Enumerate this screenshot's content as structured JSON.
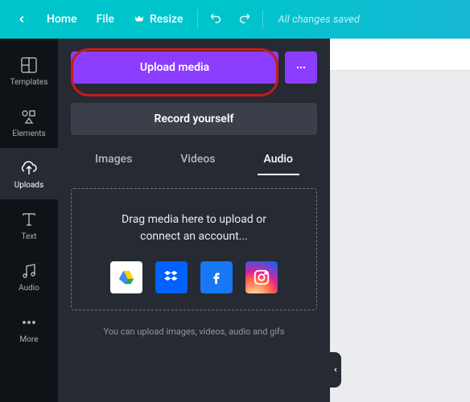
{
  "topbar": {
    "home": "Home",
    "file": "File",
    "resize": "Resize",
    "status": "All changes saved"
  },
  "leftbar": {
    "items": [
      {
        "label": "Templates"
      },
      {
        "label": "Elements"
      },
      {
        "label": "Uploads"
      },
      {
        "label": "Text"
      },
      {
        "label": "Audio"
      },
      {
        "label": "More"
      }
    ]
  },
  "panel": {
    "upload_label": "Upload media",
    "record_label": "Record yourself",
    "tabs": [
      {
        "label": "Images"
      },
      {
        "label": "Videos"
      },
      {
        "label": "Audio"
      }
    ],
    "dropzone_line1": "Drag media here to upload or",
    "dropzone_line2": "connect an account...",
    "hint": "You can upload images, videos, audio and gifs"
  }
}
